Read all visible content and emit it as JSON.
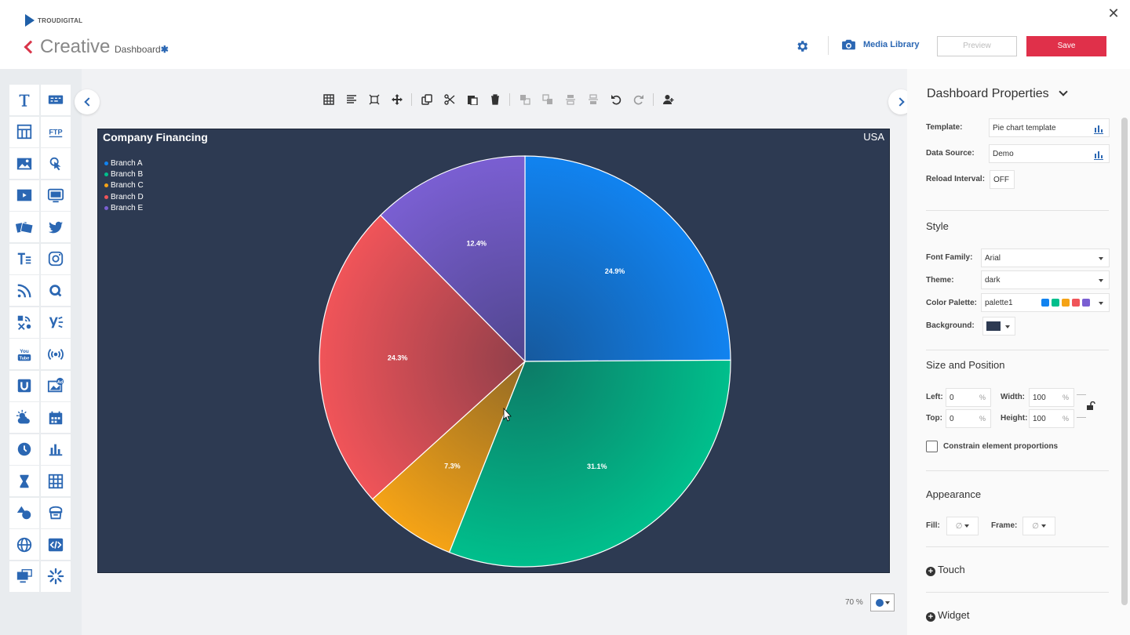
{
  "header": {
    "logo_text": "TROUDIGITAL",
    "app_title": "Creative",
    "breadcrumb": "Dashboard",
    "breadcrumb_marker": "✱",
    "media_library_label": "Media Library",
    "preview_label": "Preview",
    "save_label": "Save"
  },
  "left_toolbar": {
    "tools": [
      "text-icon",
      "ticker-icon",
      "table-layout-icon",
      "ftp-icon",
      "image-icon",
      "touch-icon",
      "video-icon",
      "screen-icon",
      "slideshow-icon",
      "twitter-icon",
      "rich-text-icon",
      "instagram-icon",
      "rss-icon",
      "queue-icon",
      "feeds-icon",
      "yammer-icon",
      "youtube-icon",
      "broadcast-icon",
      "u-icon",
      "ad-image-icon",
      "weather-icon",
      "calendar-icon",
      "clock-icon",
      "chart-icon",
      "timer-icon",
      "grid-table-icon",
      "shapes-icon",
      "menu-board-icon",
      "web-icon",
      "code-icon",
      "signage-icon",
      "loader-icon"
    ]
  },
  "edit_toolbar": {
    "tools": [
      {
        "icon": "grid-icon",
        "enabled": true
      },
      {
        "icon": "align-icon",
        "enabled": true
      },
      {
        "icon": "fit-icon",
        "enabled": true
      },
      {
        "icon": "move-icon",
        "enabled": true
      },
      {
        "icon": "sep",
        "enabled": true
      },
      {
        "icon": "copy-icon",
        "enabled": true
      },
      {
        "icon": "cut-icon",
        "enabled": true
      },
      {
        "icon": "paste-icon",
        "enabled": true
      },
      {
        "icon": "delete-icon",
        "enabled": true
      },
      {
        "icon": "sep",
        "enabled": true
      },
      {
        "icon": "bring-front-icon",
        "enabled": false
      },
      {
        "icon": "send-back-icon",
        "enabled": false
      },
      {
        "icon": "bring-forward-icon",
        "enabled": false
      },
      {
        "icon": "send-backward-icon",
        "enabled": false
      },
      {
        "icon": "undo-icon",
        "enabled": true
      },
      {
        "icon": "redo-icon",
        "enabled": false
      },
      {
        "icon": "sep",
        "enabled": true
      },
      {
        "icon": "add-user-icon",
        "enabled": true
      }
    ]
  },
  "canvas": {
    "background_color": "#2d3a52",
    "badge": "USA",
    "zoom_label": "70 %"
  },
  "chart_data": {
    "type": "pie",
    "title": "Company Financing",
    "categories": [
      "Branch A",
      "Branch B",
      "Branch C",
      "Branch D",
      "Branch E"
    ],
    "values": [
      24.9,
      31.1,
      7.3,
      24.3,
      12.4
    ],
    "value_labels": [
      "24.9%",
      "31.1%",
      "7.3%",
      "24.3%",
      "12.4%"
    ],
    "colors": [
      "#1183f0",
      "#00bf8c",
      "#f5a316",
      "#f05459",
      "#7a5fd2"
    ],
    "legend_position": "top-left",
    "start_angle_deg": 0,
    "direction": "clockwise"
  },
  "properties": {
    "title": "Dashboard Properties",
    "template_label": "Template:",
    "template_value": "Pie chart template",
    "data_source_label": "Data Source:",
    "data_source_value": "Demo",
    "reload_label": "Reload Interval:",
    "reload_value": "OFF",
    "style_title": "Style",
    "font_family_label": "Font Family:",
    "font_family_value": "Arial",
    "theme_label": "Theme:",
    "theme_value": "dark",
    "palette_label": "Color Palette:",
    "palette_value": "palette1",
    "palette_colors": [
      "#1183f0",
      "#00bf8c",
      "#f5a316",
      "#f05459",
      "#7a5fd2"
    ],
    "background_label": "Background:",
    "background_color": "#2d3a52",
    "size_title": "Size and Position",
    "left_label": "Left:",
    "left_value": "0",
    "top_label": "Top:",
    "top_value": "0",
    "width_label": "Width:",
    "width_value": "100",
    "height_label": "Height:",
    "height_value": "100",
    "percent_unit": "%",
    "constrain_label": "Constrain element proportions",
    "appearance_title": "Appearance",
    "fill_label": "Fill:",
    "frame_label": "Frame:",
    "none_glyph": "∅",
    "touch_label": "Touch",
    "widget_label": "Widget"
  }
}
